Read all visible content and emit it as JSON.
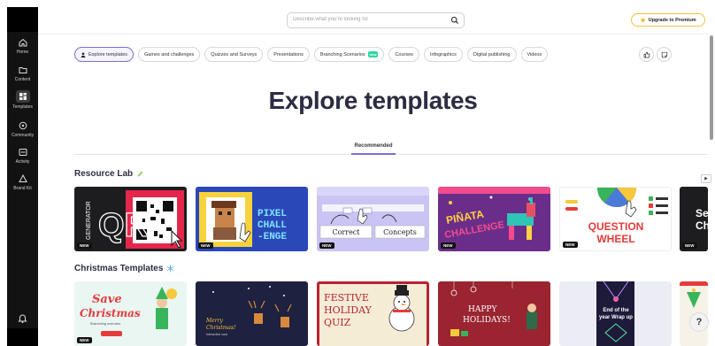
{
  "sidebar": {
    "items": [
      {
        "label": "Home",
        "icon": "home-icon"
      },
      {
        "label": "Content",
        "icon": "folder-icon"
      },
      {
        "label": "Templates",
        "icon": "templates-icon"
      },
      {
        "label": "Community",
        "icon": "community-icon"
      },
      {
        "label": "Activity",
        "icon": "activity-icon"
      },
      {
        "label": "Brand Kit",
        "icon": "brand-kit-icon"
      }
    ]
  },
  "search": {
    "placeholder": "Describe what you're looking for"
  },
  "premium": {
    "label": "Upgrade to Premium"
  },
  "chips": [
    {
      "label": "Explore templates"
    },
    {
      "label": "Games and challenges"
    },
    {
      "label": "Quizzes and Surveys"
    },
    {
      "label": "Presentations"
    },
    {
      "label": "Branching Scenarios",
      "badge": "new"
    },
    {
      "label": "Courses"
    },
    {
      "label": "Infographics"
    },
    {
      "label": "Digital publishing"
    },
    {
      "label": "Videos"
    }
  ],
  "hero": {
    "title": "Explore templates"
  },
  "tabs": {
    "recommended": "Recommended"
  },
  "sections": {
    "resource_lab": "Resource Lab",
    "christmas": "Christmas Templates"
  },
  "cards": {
    "new_label": "NEW",
    "qr": {
      "text": "QR",
      "side": "GENERATOR"
    },
    "pixel": {
      "text1": "PIXEL",
      "text2": "CHALL",
      "text3": "-ENGE"
    },
    "correct": {
      "left": "Correct",
      "right": "Concepts"
    },
    "pinata": {
      "line1": "PIÑATA",
      "line2": "CHALLENGE"
    },
    "question": {
      "line1": "QUESTION",
      "line2": "WHEEL"
    },
    "partial": {
      "line1": "Se",
      "line2": "Ch"
    },
    "save": {
      "line1": "Save",
      "line2": "Christmas",
      "sub": "Branching scenario"
    },
    "merry": {
      "line1": "Merry",
      "line2": "Christmas!",
      "sub": "Interactive card"
    },
    "festive": {
      "line1": "FESTIVE",
      "line2": "HOLIDAY",
      "line3": "QUIZ"
    },
    "happy": {
      "line1": "HAPPY",
      "line2": "HOLIDAYS!"
    },
    "wrap": {
      "line1": "End of the",
      "line2": "year Wrap up"
    }
  },
  "help": {
    "label": "?"
  }
}
